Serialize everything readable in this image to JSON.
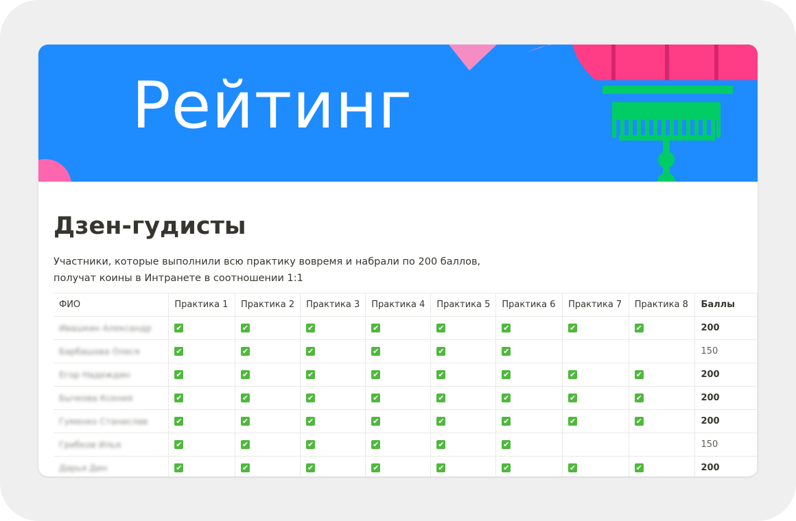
{
  "banner": {
    "title": "Рейтинг"
  },
  "page": {
    "title": "Дзен-гудисты",
    "description": "Участники, которые выполнили всю практику вовремя и набрали по 200 баллов, получат коины в Интранете в соотношении 1:1"
  },
  "colors": {
    "banner_bg": "#1e8bff",
    "pink": "#ff3d86",
    "green": "#00cc66",
    "check": "#4fb83d"
  },
  "table": {
    "headers": [
      "ФИО",
      "Практика 1",
      "Практика 2",
      "Практика 3",
      "Практика 4",
      "Практика 5",
      "Практика 6",
      "Практика 7",
      "Практика 8",
      "Баллы"
    ],
    "check_icon": "white-heavy-check-mark",
    "rows": [
      {
        "name": "Ивашкин Александр",
        "checks": [
          true,
          true,
          true,
          true,
          true,
          true,
          true,
          true
        ],
        "score": "200"
      },
      {
        "name": "Барбашова Олеся",
        "checks": [
          true,
          true,
          true,
          true,
          true,
          true,
          false,
          false
        ],
        "score": "150"
      },
      {
        "name": "Егор Надеждин",
        "checks": [
          true,
          true,
          true,
          true,
          true,
          true,
          true,
          true
        ],
        "score": "200"
      },
      {
        "name": "Бычкова Ксения",
        "checks": [
          true,
          true,
          true,
          true,
          true,
          true,
          true,
          true
        ],
        "score": "200"
      },
      {
        "name": "Гуменко Станислав",
        "checks": [
          true,
          true,
          true,
          true,
          true,
          true,
          true,
          true
        ],
        "score": "200"
      },
      {
        "name": "Грибков Илья",
        "checks": [
          true,
          true,
          true,
          true,
          true,
          true,
          false,
          false
        ],
        "score": "150"
      },
      {
        "name": "Дарья Дин",
        "checks": [
          true,
          true,
          true,
          true,
          true,
          true,
          true,
          true
        ],
        "score": "200"
      }
    ]
  }
}
